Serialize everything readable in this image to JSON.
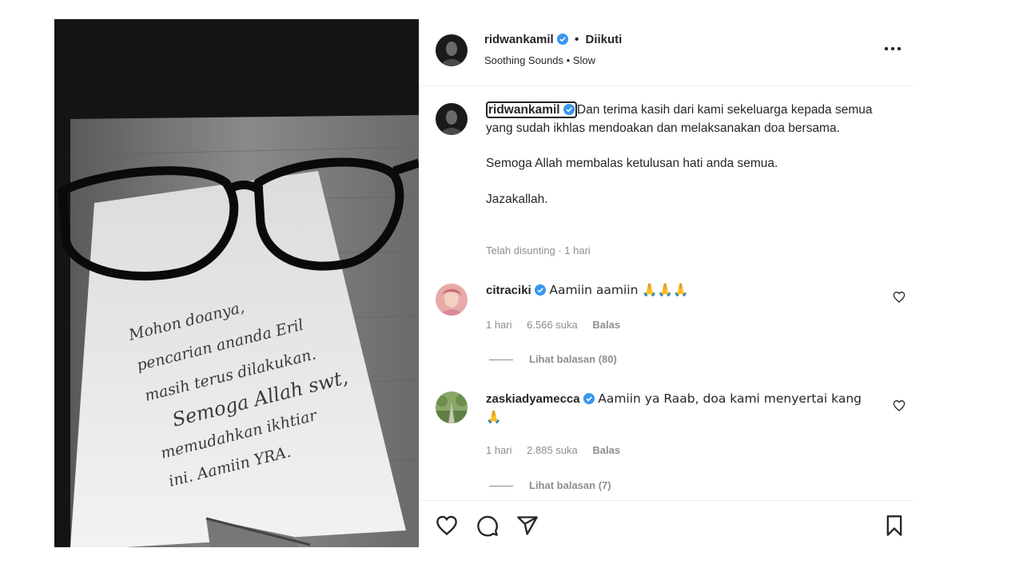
{
  "post": {
    "username": "ridwankamil",
    "follow_status": "Diikuti",
    "audio": "Soothing Sounds • Slow",
    "more_icon": "more-options-icon"
  },
  "caption": {
    "username": "ridwankamil",
    "line1": "Dan terima kasih dari kami sekeluarga kepada semua yang sudah ikhlas mendoakan dan melaksanakan doa bersama.",
    "line2": "Semoga Allah membalas ketulusan hati anda semua.",
    "line3": "Jazakallah.",
    "edited": "Telah disunting · 1 hari"
  },
  "comments": [
    {
      "username": "citraciki",
      "text": "Aamiin aamiin 🙏🙏🙏",
      "time": "1 hari",
      "likes": "6.566 suka",
      "reply_label": "Balas",
      "view_replies": "Lihat balasan (80)"
    },
    {
      "username": "zaskiadyamecca",
      "text": "Aamiin ya Raab, doa kami menyertai kang 🙏",
      "time": "1 hari",
      "likes": "2.885 suka",
      "reply_label": "Balas",
      "view_replies": "Lihat balasan (7)"
    }
  ],
  "note": {
    "handwriting": [
      "Mohon doanya,",
      "pencarian ananda Eril",
      "masih terus dilakukan.",
      "Semoga Allah swt,",
      "memudahkan ikhtiar",
      "ini. Aamiin YRA."
    ]
  },
  "colors": {
    "verified": "#3897f0",
    "muted": "#8e8e8e",
    "text": "#262626"
  }
}
